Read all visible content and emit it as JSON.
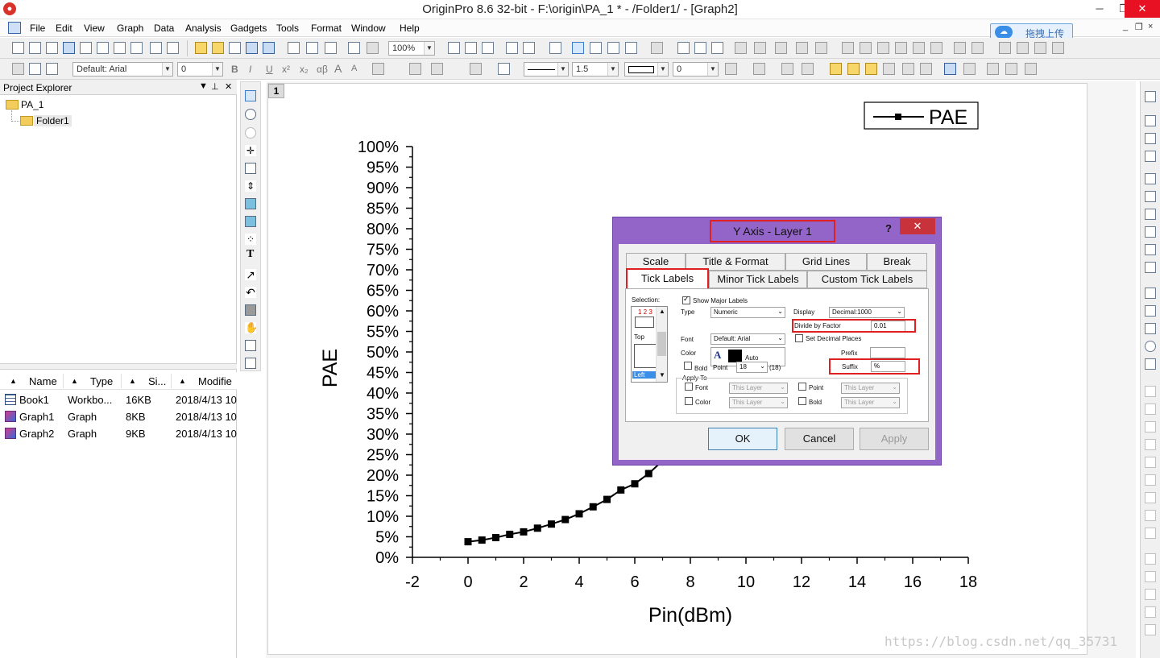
{
  "window": {
    "title": "OriginPro 8.6 32-bit - F:\\origin\\PA_1 * - /Folder1/ - [Graph2]",
    "min": "─",
    "max": "❐",
    "close": "✕",
    "mdi_min": "_",
    "mdi_restore": "❐",
    "mdi_close": "×"
  },
  "menu": [
    "File",
    "Edit",
    "View",
    "Graph",
    "Data",
    "Analysis",
    "Gadgets",
    "Tools",
    "Format",
    "Window",
    "Help"
  ],
  "upload_button": "拖拽上传",
  "toolbar": {
    "zoom": "100%",
    "font": "Default: Arial",
    "font_size": "0",
    "line_width": "1.5",
    "field_0": "0",
    "bold": "B",
    "italic": "I",
    "underline": "U",
    "superscript": "x²",
    "subscript": "x₂",
    "greek": "αβ",
    "grow_font": "A",
    "shrink_font": "A"
  },
  "project_explorer": {
    "title": "Project Explorer",
    "pin": "⊥",
    "close": "✕",
    "root": "PA_1",
    "folder": "Folder1",
    "columns": [
      "Name",
      "Type",
      "Si...",
      "Modifie"
    ],
    "rows": [
      {
        "name": "Book1",
        "type": "Workbo...",
        "size": "16KB",
        "modified": "2018/4/13 10"
      },
      {
        "name": "Graph1",
        "type": "Graph",
        "size": "8KB",
        "modified": "2018/4/13 10"
      },
      {
        "name": "Graph2",
        "type": "Graph",
        "size": "9KB",
        "modified": "2018/4/13 10"
      }
    ]
  },
  "graph": {
    "layer_tab": "1",
    "legend": "PAE"
  },
  "chart_data": {
    "type": "line",
    "xlabel": "Pin(dBm)",
    "ylabel": "PAE",
    "xlim": [
      -2,
      18
    ],
    "ylim": [
      0,
      100
    ],
    "x_ticks": [
      "-2",
      "0",
      "2",
      "4",
      "6",
      "8",
      "10",
      "12",
      "14",
      "16",
      "18"
    ],
    "y_ticks": [
      "0%",
      "5%",
      "10%",
      "15%",
      "20%",
      "25%",
      "30%",
      "35%",
      "40%",
      "45%",
      "50%",
      "55%",
      "60%",
      "65%",
      "70%",
      "75%",
      "80%",
      "85%",
      "90%",
      "95%",
      "100%"
    ],
    "legend_position": "top-right",
    "grid": false,
    "series": [
      {
        "name": "PAE",
        "x": [
          0,
          0.5,
          1,
          1.5,
          2,
          2.5,
          3,
          3.5,
          4,
          4.5,
          5,
          5.5,
          6,
          6.5,
          7
        ],
        "y": [
          3.8,
          4.2,
          4.8,
          5.6,
          6.2,
          7.1,
          8.1,
          9.2,
          10.6,
          12.3,
          14.1,
          16.4,
          17.9,
          20.4,
          23.5
        ]
      }
    ]
  },
  "dialog": {
    "title": "Y Axis - Layer 1",
    "help": "?",
    "close": "✕",
    "tabs_row1": [
      "Scale",
      "Title & Format",
      "Grid Lines",
      "Break"
    ],
    "tabs_row2": [
      "Tick Labels",
      "Minor Tick Labels",
      "Custom Tick Labels"
    ],
    "selection_label": "Selection:",
    "selection_nums": "1 2 3",
    "selection_top": "Top",
    "selection_left": "Left",
    "show_major_labels": "Show Major Labels",
    "type_label": "Type",
    "type_value": "Numeric",
    "display_label": "Display",
    "display_value": "Decimal:1000",
    "divide_label": "Divide by Factor",
    "divide_value": "0.01",
    "set_decimal": "Set Decimal Places",
    "font_label": "Font",
    "font_value": "Default: Arial",
    "prefix_label": "Prefix",
    "prefix_value": "",
    "color_label": "Color",
    "color_value": "Auto",
    "color_letter": "A",
    "suffix_label": "Suffix",
    "suffix_value": "%",
    "bold_label": "Bold",
    "point_label": "Point",
    "point_value": "18",
    "point_paren": "(18)",
    "apply_to": "Apply To",
    "apply_font": "Font",
    "apply_color": "Color",
    "apply_point": "Point",
    "apply_bold": "Bold",
    "this_layer": "This Layer",
    "ok": "OK",
    "cancel": "Cancel",
    "apply": "Apply"
  },
  "watermark": "https://blog.csdn.net/qq_35731"
}
